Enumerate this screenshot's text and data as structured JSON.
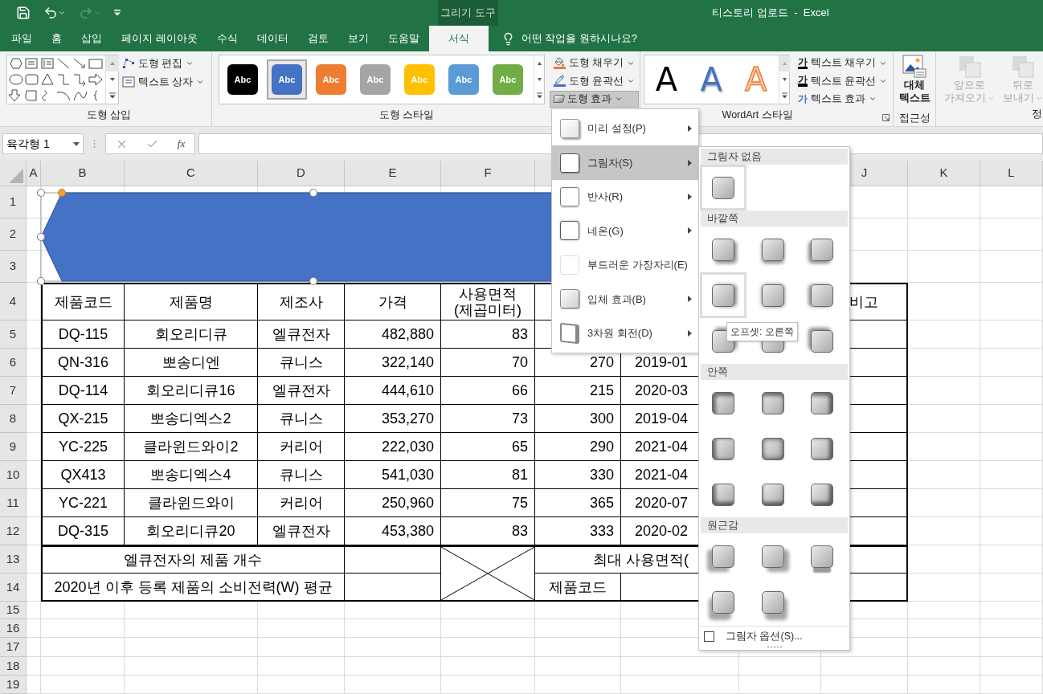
{
  "title_bar": {
    "context_label": "그리기 도구",
    "title": "티스토리 업로드  -  Excel"
  },
  "tabs": [
    {
      "label": "파일",
      "selected": false
    },
    {
      "label": "홈",
      "selected": false
    },
    {
      "label": "삽입",
      "selected": false
    },
    {
      "label": "페이지 레이아웃",
      "selected": false
    },
    {
      "label": "수식",
      "selected": false
    },
    {
      "label": "데이터",
      "selected": false
    },
    {
      "label": "검토",
      "selected": false
    },
    {
      "label": "보기",
      "selected": false
    },
    {
      "label": "도움말",
      "selected": false
    },
    {
      "label": "서식",
      "selected": true
    }
  ],
  "tell_me": "어떤 작업을 원하시나요?",
  "ribbon": {
    "insert_shapes": {
      "edit_shape": "도형 편집",
      "text_box": "텍스트 상자",
      "label": "도형 삽입"
    },
    "shape_styles": {
      "swatches": [
        {
          "label": "Abc",
          "color": "#000000",
          "selected": false
        },
        {
          "label": "Abc",
          "color": "#4472c4",
          "selected": true
        },
        {
          "label": "Abc",
          "color": "#ed7d31",
          "selected": false
        },
        {
          "label": "Abc",
          "color": "#a5a5a5",
          "selected": false
        },
        {
          "label": "Abc",
          "color": "#ffc000",
          "selected": false
        },
        {
          "label": "Abc",
          "color": "#5b9bd5",
          "selected": false
        },
        {
          "label": "Abc",
          "color": "#70ad47",
          "selected": false
        }
      ],
      "fill": "도형 채우기",
      "outline": "도형 윤곽선",
      "effects": {
        "label": "도형 효과",
        "pressed": true
      },
      "label": "도형 스타일"
    },
    "wordart": {
      "letters": [
        {
          "label": "A",
          "kind": "plain"
        },
        {
          "label": "A",
          "kind": "shadow"
        },
        {
          "label": "A",
          "kind": "outline"
        }
      ],
      "text_fill": {
        "glyph": "가",
        "label": "텍스트 채우기"
      },
      "text_outline": {
        "glyph": "가",
        "label": "텍스트 윤곽선"
      },
      "text_effects": {
        "glyph": "가",
        "label": "텍스트 효과"
      },
      "label": "WordArt 스타일"
    },
    "accessibility": {
      "alt_text": [
        "대체",
        "텍스트"
      ],
      "label": "접근성"
    },
    "arrange": {
      "bring_forward": {
        "lines": [
          "앞으로",
          "가져오기"
        ],
        "disabled": true
      },
      "send_backward": {
        "lines": [
          "뒤로",
          "보내기"
        ],
        "disabled": true
      },
      "label": "정"
    }
  },
  "formula_bar": {
    "name_box": "육각형 1",
    "fx": "fx"
  },
  "sheet": {
    "column_headers": [
      "A",
      "B",
      "C",
      "D",
      "E",
      "F",
      "J",
      "K",
      "L"
    ],
    "row_headers": [
      "1",
      "2",
      "3",
      "4",
      "5",
      "6",
      "7",
      "8",
      "9",
      "10",
      "11",
      "12",
      "13",
      "14",
      "15",
      "16",
      "17",
      "18",
      "19"
    ],
    "table": {
      "header": {
        "code": "제품코드",
        "name": "제품명",
        "maker": "제조사",
        "price": "가격",
        "area": [
          "사용면적",
          "(제곱미터)"
        ],
        "remark": "비고"
      },
      "rows": [
        {
          "code": "DQ-115",
          "name": "회오리디큐",
          "maker": "엘큐전자",
          "price": "482,880",
          "area": "83"
        },
        {
          "code": "QN-316",
          "name": "뽀송디엔",
          "maker": "큐니스",
          "price": "322,140",
          "area": "70",
          "power": "270",
          "date": "2019-01"
        },
        {
          "code": "DQ-114",
          "name": "회오리디큐16",
          "maker": "엘큐전자",
          "price": "444,610",
          "area": "66",
          "power": "215",
          "date": "2020-03"
        },
        {
          "code": "QX-215",
          "name": "뽀송디엑스2",
          "maker": "큐니스",
          "price": "353,270",
          "area": "73",
          "power": "300",
          "date": "2019-04"
        },
        {
          "code": "YC-225",
          "name": "클라윈드와이2",
          "maker": "커리어",
          "price": "222,030",
          "area": "65",
          "power": "290",
          "date": "2021-04"
        },
        {
          "code": "QX413",
          "name": "뽀송디엑스4",
          "maker": "큐니스",
          "price": "541,030",
          "area": "81",
          "power": "330",
          "date": "2021-04"
        },
        {
          "code": "YC-221",
          "name": "클라윈드와이",
          "maker": "커리어",
          "price": "250,960",
          "area": "75",
          "power": "365",
          "date": "2020-07"
        },
        {
          "code": "DQ-315",
          "name": "회오리디큐20",
          "maker": "엘큐전자",
          "price": "453,380",
          "area": "83",
          "power": "333",
          "date": "2020-02"
        }
      ],
      "summary": {
        "count_label": "엘큐전자의 제품 개수",
        "avg_label": "2020년 이후 등록 제품의 소비전력(W) 평균",
        "max_label": "최대 사용면적(",
        "code_label": "제품코드"
      }
    }
  },
  "effects_menu": {
    "items": [
      {
        "label": "미리 설정(P)",
        "kind": "preset",
        "selected": false
      },
      {
        "label": "그림자(S)",
        "kind": "shadow",
        "selected": true
      },
      {
        "label": "반사(R)",
        "kind": "reflection",
        "selected": false
      },
      {
        "label": "네온(G)",
        "kind": "glow",
        "selected": false
      },
      {
        "label": "부드러운 가장자리(E)",
        "kind": "soft_edges",
        "selected": false
      },
      {
        "label": "입체 효과(B)",
        "kind": "bevel",
        "selected": false
      },
      {
        "label": "3차원 회전(D)",
        "kind": "rotation",
        "selected": false
      }
    ]
  },
  "shadow_gallery": {
    "sections": [
      {
        "title": "그림자 없음",
        "tiles": [
          {
            "kind": "none",
            "selected": true
          }
        ]
      },
      {
        "title": "바깥쪽",
        "tiles": [
          {
            "kind": "outer",
            "selected": false
          },
          {
            "kind": "outer",
            "selected": false
          },
          {
            "kind": "outer",
            "selected": false
          },
          {
            "kind": "outer",
            "selected": true
          },
          {
            "kind": "outer",
            "selected": false
          },
          {
            "kind": "outer",
            "selected": false
          },
          {
            "kind": "outer",
            "selected": false
          },
          {
            "kind": "outer",
            "selected": false
          },
          {
            "kind": "outer",
            "selected": false
          }
        ]
      },
      {
        "title": "안쪽",
        "tiles": [
          {
            "kind": "inner",
            "selected": false
          },
          {
            "kind": "inner",
            "selected": false
          },
          {
            "kind": "inner",
            "selected": false
          },
          {
            "kind": "inner",
            "selected": false
          },
          {
            "kind": "inner",
            "selected": false
          },
          {
            "kind": "inner",
            "selected": false
          },
          {
            "kind": "inner",
            "selected": false
          },
          {
            "kind": "inner",
            "selected": false
          },
          {
            "kind": "inner",
            "selected": false
          }
        ]
      },
      {
        "title": "원근감",
        "tiles": [
          {
            "kind": "perspective",
            "selected": false
          },
          {
            "kind": "perspective",
            "selected": false
          },
          {
            "kind": "perspective",
            "selected": false
          },
          {
            "kind": "perspective",
            "selected": false
          },
          {
            "kind": "perspective",
            "selected": false
          }
        ]
      }
    ],
    "tooltip": "오프셋: 오른쪽",
    "options": {
      "label": "그림자 옵션(S)...",
      "checked": false
    }
  }
}
